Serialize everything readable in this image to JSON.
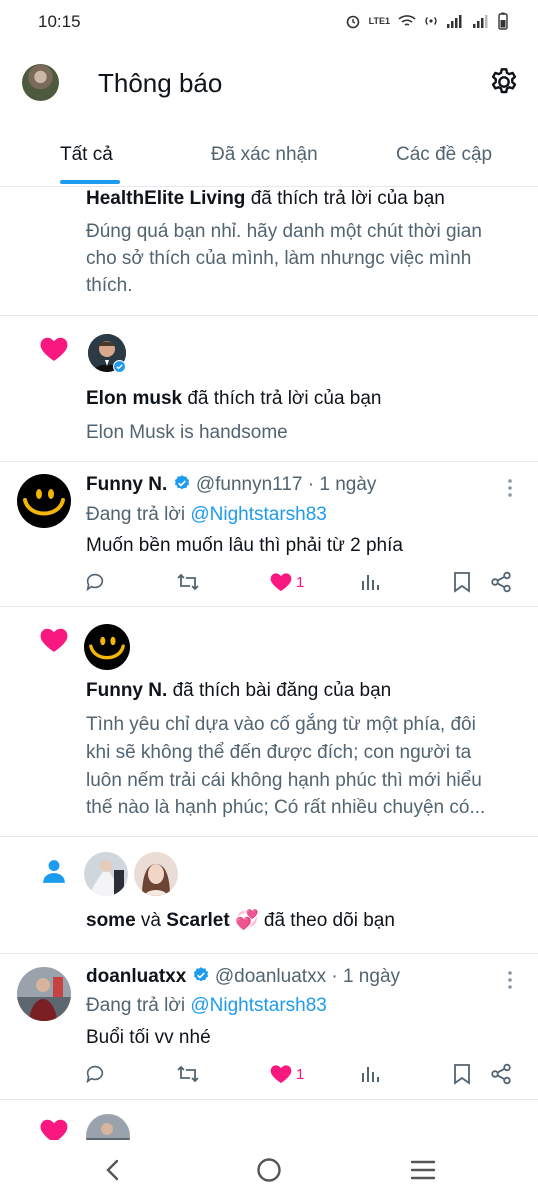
{
  "status": {
    "time": "10:15",
    "network": "LTE1"
  },
  "header": {
    "title": "Thông báo"
  },
  "tabs": [
    "Tất cả",
    "Đã xác nhận",
    "Các đề cập"
  ],
  "n1": {
    "user": "HealthElite Living",
    "action": "đã thích trả lời của bạn",
    "lines": [
      "Đúng quá bạn nhỉ. hãy danh một chút thời gian",
      "cho sở thích của mình, làm nhưngc việc mình",
      "thích."
    ]
  },
  "n2": {
    "user": "Elon musk",
    "action": "đã thích trả lời của bạn",
    "preview": "Elon Musk is handsome"
  },
  "t1": {
    "name": "Funny N.",
    "handle": "@funnyn117",
    "time": "· 1 ngày",
    "reply_prefix": "Đang trả lời",
    "reply_to": "@Nightstarsh83",
    "text": "Muốn bền muốn lâu thì phải từ 2 phía",
    "likes": "1"
  },
  "n3": {
    "user": "Funny N.",
    "action": "đã thích bài đăng của bạn",
    "lines": [
      "Tình yêu chỉ dựa vào cố gắng từ một phía, đôi",
      "khi sẽ không thể đến được đích; con người ta",
      "luôn nếm trải cái không hạnh phúc thì mới hiểu",
      "thế nào là hạnh phúc; Có rất nhiều chuyện có..."
    ]
  },
  "n4": {
    "user1": "some",
    "conj": "và",
    "user2": "Scarlet",
    "emoji": "💞",
    "action": "đã theo dõi bạn"
  },
  "t2": {
    "name": "doanluatxx",
    "handle": "@doanluatxx",
    "time": "· 1 ngày",
    "reply_prefix": "Đang trả lời",
    "reply_to": "@Nightstarsh83",
    "text": "Buổi tối vv nhé",
    "likes": "1"
  },
  "colors": {
    "accent": "#1d9bf0",
    "like": "#f91880",
    "verified": "#1d9bf0",
    "follow": "#1d9bf0"
  }
}
